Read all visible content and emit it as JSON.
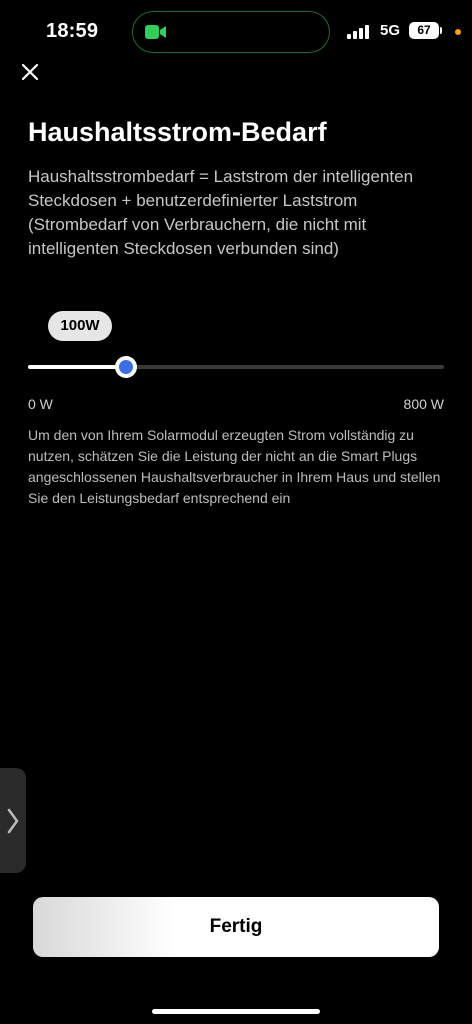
{
  "status_bar": {
    "time": "18:59",
    "network": "5G",
    "battery": "67",
    "icons": [
      "facetime-camera-icon",
      "signal-icon",
      "battery-icon"
    ]
  },
  "header": {
    "close_icon": "close-icon",
    "title": "Haushaltsstrom-Bedarf"
  },
  "description": "Haushaltsstrombedarf = Laststrom der intelligenten Steckdosen + benutzerdefinierter Laststrom (Strombedarf von Verbrauchern, die nicht mit intelligenten Steckdosen verbunden sind)",
  "slider": {
    "value_label": "100W",
    "value": 100,
    "min": 0,
    "max": 800,
    "min_label": "0 W",
    "max_label": "800 W",
    "accent_color": "#3a6fe8"
  },
  "info_text": "Um den von Ihrem Solarmodul erzeugten Strom vollständig zu nutzen, schätzen Sie die Leistung der nicht an die Smart Plugs angeschlossenen Haushaltsverbraucher in Ihrem Haus und stellen Sie den Leistungsbedarf entsprechend ein",
  "side_handle_icon": "chevron-right-icon",
  "footer": {
    "done_label": "Fertig"
  }
}
